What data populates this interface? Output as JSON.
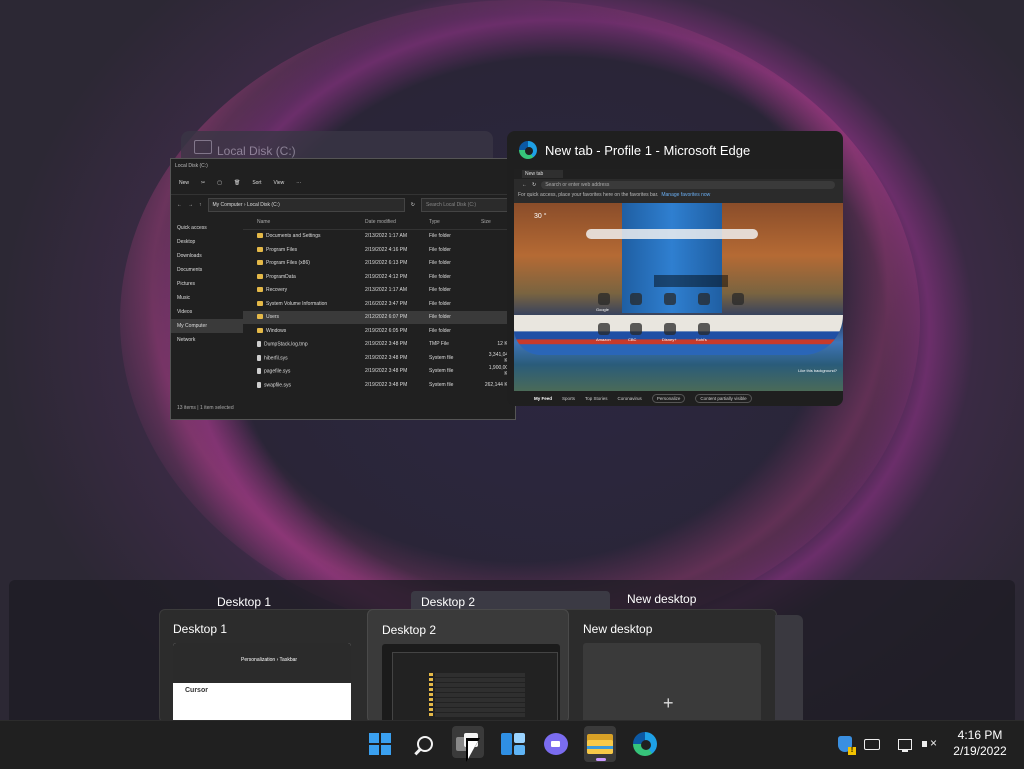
{
  "windows": {
    "explorer": {
      "title": "Local Disk (C:)",
      "mini_title": "Local Disk (C:)",
      "toolbar": [
        "New",
        "Sort",
        "View"
      ],
      "breadcrumb": "My Computer  ›  Local Disk (C:)",
      "search_placeholder": "Search Local Disk (C:)",
      "nav": [
        "Quick access",
        "Desktop",
        "Downloads",
        "Documents",
        "Pictures",
        "Music",
        "Videos",
        "My Computer",
        "Network"
      ],
      "columns": [
        "Name",
        "Date modified",
        "Type",
        "Size"
      ],
      "files": [
        {
          "name": "Documents and Settings",
          "date": "2/13/2022 1:17 AM",
          "type": "File folder",
          "size": ""
        },
        {
          "name": "Program Files",
          "date": "2/19/2022 4:16 PM",
          "type": "File folder",
          "size": ""
        },
        {
          "name": "Program Files (x86)",
          "date": "2/19/2022 6:13 PM",
          "type": "File folder",
          "size": ""
        },
        {
          "name": "ProgramData",
          "date": "2/19/2022 4:12 PM",
          "type": "File folder",
          "size": ""
        },
        {
          "name": "Recovery",
          "date": "2/13/2022 1:17 AM",
          "type": "File folder",
          "size": ""
        },
        {
          "name": "System Volume Information",
          "date": "2/16/2022 3:47 PM",
          "type": "File folder",
          "size": ""
        },
        {
          "name": "Users",
          "date": "2/12/2022 6:07 PM",
          "type": "File folder",
          "size": ""
        },
        {
          "name": "Windows",
          "date": "2/19/2022 6:05 PM",
          "type": "File folder",
          "size": ""
        },
        {
          "name": "DumpStack.log.tmp",
          "date": "2/19/2022 3:48 PM",
          "type": "TMP File",
          "size": "12 KB"
        },
        {
          "name": "hiberfil.sys",
          "date": "2/19/2022 3:48 PM",
          "type": "System file",
          "size": "3,341,048 KB"
        },
        {
          "name": "pagefile.sys",
          "date": "2/19/2022 3:48 PM",
          "type": "System file",
          "size": "1,900,000 KB"
        },
        {
          "name": "swapfile.sys",
          "date": "2/19/2022 3:48 PM",
          "type": "System file",
          "size": "262,144 KB"
        }
      ],
      "status": "13 items  |  1 item selected"
    },
    "edge": {
      "title": "New tab - Profile 1 - Microsoft Edge",
      "tab_label": "New tab",
      "url_placeholder": "Search or enter web address",
      "favorites_hint": "For quick access, place your favorites here on the favorites bar.",
      "favorites_link": "Manage favorites now",
      "weather": "30 °",
      "tiles": [
        "Google",
        "",
        "",
        "",
        "",
        "Amazon",
        "CBC",
        "Disney+",
        "Kohl's"
      ],
      "like_bg": "Like this background?",
      "feed": {
        "active": "My Feed",
        "items": [
          "Sports",
          "Top Stories",
          "Coronavirus"
        ],
        "personalize": "Personalize",
        "visibility": "Content partially visible"
      }
    }
  },
  "desktops": {
    "header_labels": [
      "Desktop 1",
      "Desktop 2",
      "New desktop"
    ],
    "cards": [
      {
        "name": "Desktop 1",
        "thumb_header": "Personalization  ›  Taskbar",
        "thumb_logo": "Cursor"
      },
      {
        "name": "Desktop 2"
      },
      {
        "name": "New desktop",
        "plus": "+"
      }
    ]
  },
  "taskbar": {
    "icons": [
      "start-icon",
      "search-icon",
      "task-view-icon",
      "widgets-icon",
      "chat-icon",
      "file-explorer-icon",
      "edge-icon"
    ],
    "tray": [
      "security-warning-icon",
      "keyboard-icon",
      "network-icon",
      "volume-muted-icon"
    ],
    "time": "4:16 PM",
    "date": "2/19/2022"
  },
  "colors": {
    "accent": "#3aa0f0",
    "indicator": "#c799ff"
  }
}
